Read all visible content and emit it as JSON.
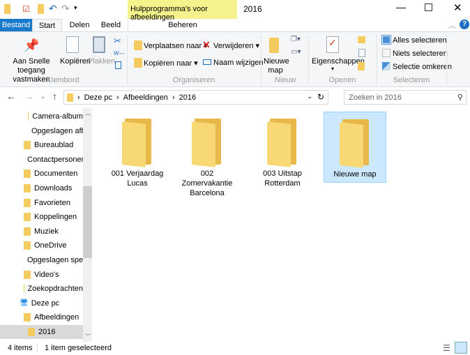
{
  "window": {
    "title": "2016",
    "contextual_tab": "Hulpprogramma's voor afbeeldingen",
    "contextual_subtab": "Beheren"
  },
  "tabs": [
    {
      "label": "Bestand"
    },
    {
      "label": "Start"
    },
    {
      "label": "Delen"
    },
    {
      "label": "Beeld"
    }
  ],
  "ribbon": {
    "klembord": {
      "label": "Klembord",
      "pin": "Aan Snelle toegang vastmaken",
      "copy": "Kopiëren",
      "paste": "Plakken"
    },
    "organiseren": {
      "label": "Organiseren",
      "move": "Verplaatsen naar",
      "copyto": "Kopiëren naar",
      "delete": "Verwijderen",
      "rename": "Naam wijzigen"
    },
    "nieuw": {
      "label": "Nieuw",
      "newfolder": "Nieuwe map"
    },
    "openen": {
      "label": "Openen",
      "properties": "Eigenschappen"
    },
    "selecteren": {
      "label": "Selecteren",
      "all": "Alles selecteren",
      "none": "Niets selecteren",
      "invert": "Selectie omkeren"
    }
  },
  "address": {
    "crumbs": [
      "Deze pc",
      "Afbeeldingen",
      "2016"
    ],
    "search_placeholder": "Zoeken in 2016"
  },
  "nav": [
    {
      "label": "Camera-album",
      "indent": 2
    },
    {
      "label": "Opgeslagen afbeeldingen",
      "indent": 2
    },
    {
      "label": "Bureaublad",
      "indent": 1
    },
    {
      "label": "Contactpersonen",
      "indent": 1
    },
    {
      "label": "Documenten",
      "indent": 1
    },
    {
      "label": "Downloads",
      "indent": 1
    },
    {
      "label": "Favorieten",
      "indent": 1
    },
    {
      "label": "Koppelingen",
      "indent": 1
    },
    {
      "label": "Muziek",
      "indent": 1
    },
    {
      "label": "OneDrive",
      "indent": 1
    },
    {
      "label": "Opgeslagen spellen",
      "indent": 1
    },
    {
      "label": "Video's",
      "indent": 1
    },
    {
      "label": "Zoekopdrachten",
      "indent": 1
    },
    {
      "label": "Deze pc",
      "indent": 0
    },
    {
      "label": "Afbeeldingen",
      "indent": 1
    },
    {
      "label": "2016",
      "indent": 2,
      "selected": true
    }
  ],
  "files": [
    {
      "name": "001 Verjaardag Lucas"
    },
    {
      "name": "002 Zomervakantie Barcelona"
    },
    {
      "name": "003 Uitstap Rotterdam"
    },
    {
      "name": "Nieuwe map",
      "selected": true
    }
  ],
  "status": {
    "count": "4 items",
    "selected": "1 item geselecteerd"
  }
}
